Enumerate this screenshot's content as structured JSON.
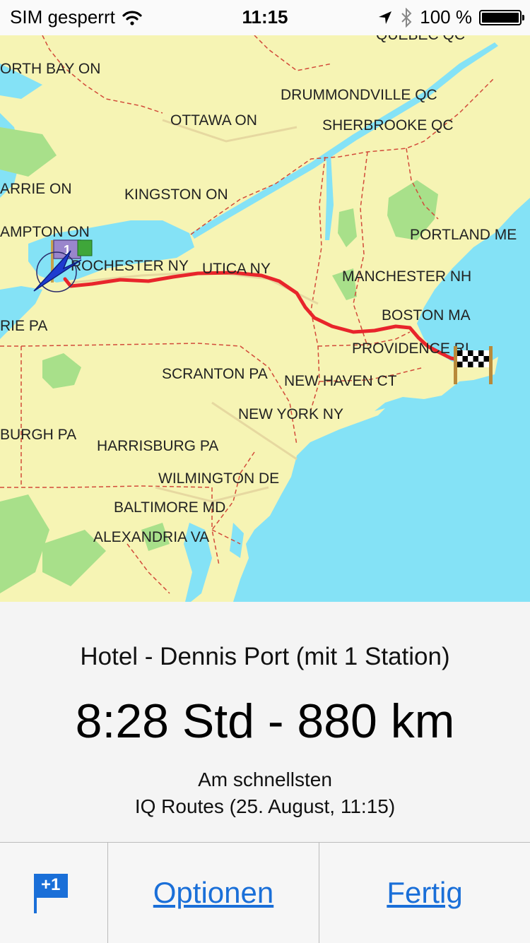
{
  "status_bar": {
    "carrier": "SIM gesperrt",
    "time": "11:15",
    "battery": "100 %",
    "battery_level": 1.0
  },
  "map": {
    "cities": [
      {
        "name": "QUEBEC QC"
      },
      {
        "name": "ORTH BAY ON"
      },
      {
        "name": "DRUMMONDVILLE QC"
      },
      {
        "name": "OTTAWA ON"
      },
      {
        "name": "SHERBROOKE QC"
      },
      {
        "name": "ARRIE ON"
      },
      {
        "name": "KINGSTON ON"
      },
      {
        "name": "AMPTON ON"
      },
      {
        "name": "PORTLAND ME"
      },
      {
        "name": "ROCHESTER NY"
      },
      {
        "name": "UTICA NY"
      },
      {
        "name": "MANCHESTER NH"
      },
      {
        "name": "RIE PA"
      },
      {
        "name": "BOSTON MA"
      },
      {
        "name": "PROVIDENCE RI"
      },
      {
        "name": "SCRANTON PA"
      },
      {
        "name": "NEW HAVEN CT"
      },
      {
        "name": "NEW YORK NY"
      },
      {
        "name": "BURGH PA"
      },
      {
        "name": "HARRISBURG PA"
      },
      {
        "name": "WILMINGTON DE"
      },
      {
        "name": "BALTIMORE MD"
      },
      {
        "name": "ALEXANDRIA VA"
      }
    ],
    "start_marker_label": "1",
    "colors": {
      "land": "#f6f4b4",
      "water": "#84e2f6",
      "forest": "#a8e08a",
      "route": "#e8252b",
      "border": "#d24b3a"
    }
  },
  "route": {
    "title": "Hotel - Dennis Port (mit 1 Station)",
    "summary": "8:28 Std - 880 km",
    "mode": "Am schnellsten",
    "traffic": "IQ Routes (25. August, 11:15)"
  },
  "toolbar": {
    "add_stop_badge": "+1",
    "options_label": "Optionen",
    "done_label": "Fertig",
    "accent": "#1a6fd8"
  }
}
